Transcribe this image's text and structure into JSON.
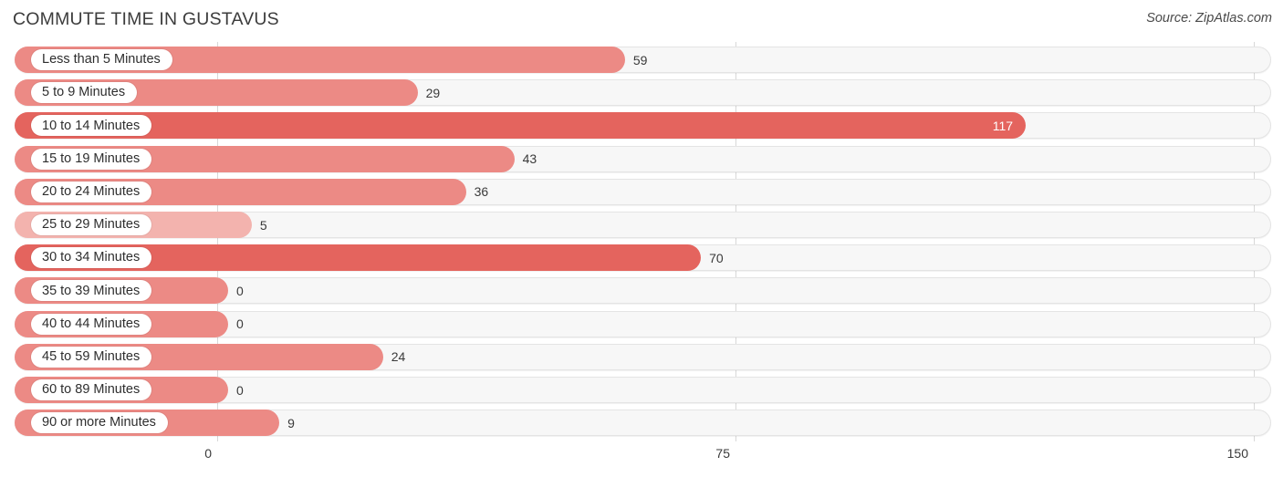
{
  "header": {
    "title": "COMMUTE TIME IN GUSTAVUS",
    "source": "Source: ZipAtlas.com"
  },
  "colors": {
    "bar_default": "#ec8a85",
    "bar_strong": "#e4645e",
    "bar_light": "#f3b3ae",
    "track": "#f7f7f7",
    "grid": "#d8d8d8",
    "text": "#3a3a3a"
  },
  "axis": {
    "ticks": [
      "0",
      "75",
      "150"
    ],
    "min": 0,
    "max": 150
  },
  "chart_data": {
    "type": "bar",
    "orientation": "horizontal",
    "title": "COMMUTE TIME IN GUSTAVUS",
    "xlabel": "",
    "ylabel": "",
    "xlim": [
      0,
      150
    ],
    "grid": true,
    "legend": "none",
    "source": "Source: ZipAtlas.com",
    "categories": [
      "Less than 5 Minutes",
      "5 to 9 Minutes",
      "10 to 14 Minutes",
      "15 to 19 Minutes",
      "20 to 24 Minutes",
      "25 to 29 Minutes",
      "30 to 34 Minutes",
      "35 to 39 Minutes",
      "40 to 44 Minutes",
      "45 to 59 Minutes",
      "60 to 89 Minutes",
      "90 or more Minutes"
    ],
    "values": [
      59,
      29,
      117,
      43,
      36,
      5,
      70,
      0,
      0,
      24,
      0,
      9
    ],
    "value_labels": [
      "59",
      "29",
      "117",
      "43",
      "36",
      "5",
      "70",
      "0",
      "0",
      "24",
      "0",
      "9"
    ]
  },
  "rows": [
    {
      "label": "Less than 5 Minutes",
      "value": 59,
      "value_label": "59",
      "style": "default",
      "inside": false
    },
    {
      "label": "5 to 9 Minutes",
      "value": 29,
      "value_label": "29",
      "style": "default",
      "inside": false
    },
    {
      "label": "10 to 14 Minutes",
      "value": 117,
      "value_label": "117",
      "style": "strong",
      "inside": true
    },
    {
      "label": "15 to 19 Minutes",
      "value": 43,
      "value_label": "43",
      "style": "default",
      "inside": false
    },
    {
      "label": "20 to 24 Minutes",
      "value": 36,
      "value_label": "36",
      "style": "default",
      "inside": false
    },
    {
      "label": "25 to 29 Minutes",
      "value": 5,
      "value_label": "5",
      "style": "light",
      "inside": false
    },
    {
      "label": "30 to 34 Minutes",
      "value": 70,
      "value_label": "70",
      "style": "strong",
      "inside": false
    },
    {
      "label": "35 to 39 Minutes",
      "value": 0,
      "value_label": "0",
      "style": "default",
      "inside": false
    },
    {
      "label": "40 to 44 Minutes",
      "value": 0,
      "value_label": "0",
      "style": "default",
      "inside": false
    },
    {
      "label": "45 to 59 Minutes",
      "value": 24,
      "value_label": "24",
      "style": "default",
      "inside": false
    },
    {
      "label": "60 to 89 Minutes",
      "value": 0,
      "value_label": "0",
      "style": "default",
      "inside": false
    },
    {
      "label": "90 or more Minutes",
      "value": 9,
      "value_label": "9",
      "style": "default",
      "inside": false
    }
  ]
}
